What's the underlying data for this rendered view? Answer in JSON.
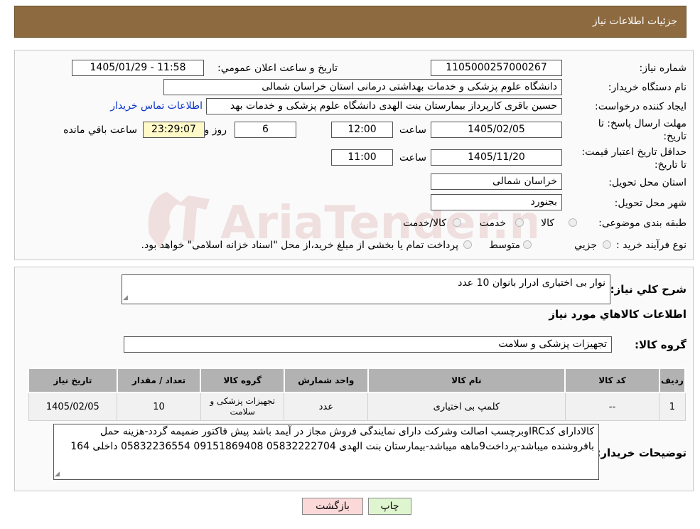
{
  "header": {
    "title": "جزئیات اطلاعات نیاز"
  },
  "labels": {
    "need_number": "شماره نیاز:",
    "announce_datetime": "تاريخ و ساعت اعلان عمومي:",
    "buyer_org": "نام دستگاه خريدار:",
    "requester": "ايجاد کننده درخواست:",
    "deadline": "مهلت ارسال پاسخ: تا تاریخ:",
    "min_validity": "حداقل تاريخ اعتبار قيمت: تا تاريخ:",
    "time": "ساعت",
    "days": "روز و",
    "remaining": "ساعت باقي مانده",
    "province": "استان محل تحويل:",
    "city": "شهر محل تحويل:",
    "category": "طبقه بندی موضوعی:",
    "process_type": "نوع فرآيند خريد :",
    "description": "شرح کلي نياز:",
    "goods_info": "اطلاعات کالاهاي مورد نياز",
    "goods_group": "گروه کالا:",
    "buyer_notes": "توضيحات خريدار:"
  },
  "values": {
    "need_number": "1105000257000267",
    "announce_datetime": "1405/01/29 - 11:58",
    "buyer_org": "دانشگاه علوم پزشکی و خدمات بهداشتی درمانی استان خراسان شمالی",
    "requester": "حسین باقری کارپرداز بیمارستان بنت الهدی دانشگاه علوم پزشکی و خدمات بهد",
    "contact_link": "اطلاعات تماس خریدار",
    "deadline_date": "1405/02/05",
    "deadline_time": "12:00",
    "days_left": "6",
    "time_left": "23:29:07",
    "validity_date": "1405/11/20",
    "validity_time": "11:00",
    "province": "خراسان شمالی",
    "city": "بجنورد",
    "description": "نوار بی اختیاری ادرار بانوان 10 عدد",
    "goods_group": "تجهیزات پزشکی و سلامت",
    "buyer_notes": "کالادارای کدIRCوبرچسب اصالت وشرکت دارای نمایندگی فروش مجاز در آیمد باشد پیش فاکتور ضمیمه گردد-هزینه حمل بافروشنده میباشد-پرداخت9ماهه میباشد-بیمارستان بنت الهدی 05832222704 09151869408 05832236554  داخلی 164"
  },
  "category_options": [
    "کالا",
    "خدمت",
    "کالا/خدمت"
  ],
  "process_options": [
    "جزيي",
    "متوسط"
  ],
  "process_note": "پرداخت تمام یا بخشی از مبلغ خرید،از محل \"اسناد خزانه اسلامی\" خواهد بود.",
  "table": {
    "headers": [
      "رديف",
      "کد کالا",
      "نام کالا",
      "واحد شمارش",
      "گروه کالا",
      "تعداد / مقدار",
      "تاريخ نياز"
    ],
    "row": [
      "1",
      "--",
      "کلمپ بی اختیاری",
      "عدد",
      "تجهیزات پزشکی و سلامت",
      "10",
      "1405/02/05"
    ]
  },
  "buttons": {
    "print": "چاپ",
    "back": "بازگشت"
  },
  "watermark": "AriaTender.neT",
  "colors": {
    "header_bg": "#8d6a3f",
    "link": "#0b35c9",
    "back_btn": "#fbd9d9",
    "print_btn": "#dff5d0"
  }
}
